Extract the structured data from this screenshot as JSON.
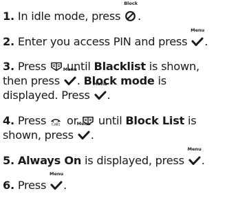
{
  "icons": {
    "menu": {
      "name": "menu-icon",
      "caption": "Menu"
    },
    "block": {
      "name": "block-icon",
      "caption": "Block"
    },
    "phonebook": {
      "name": "phonebook-icon"
    },
    "calls": {
      "name": "calls-icon"
    }
  },
  "steps": [
    {
      "number": "1.",
      "line1_a": " In idle mode, press ",
      "line1_end": "."
    },
    {
      "number": "2.",
      "line1_a": " Enter you access PIN and press ",
      "line1_end": "."
    },
    {
      "number": "3.",
      "line1_a": " Press ",
      "line1_b": " until ",
      "bold1": "Blacklist",
      "line1_c": " is shown,",
      "line2_a": "then press ",
      "line2_b": ". ",
      "bold2": "Block mode",
      "line2_c": " is",
      "line3_a": "displayed. Press ",
      "line3_end": "."
    },
    {
      "number": "4.",
      "line1_a": " Press ",
      "line1_b": " or ",
      "line1_c": " until ",
      "bold1": "Block List",
      "line1_d": " is",
      "line2_a": "shown, press ",
      "line2_end": "."
    },
    {
      "number": "5.",
      "bold1": "Always On",
      "line1_a": " is displayed, press ",
      "line1_end": "."
    },
    {
      "number": "6.",
      "line1_a": " Press ",
      "line1_end": "."
    }
  ]
}
